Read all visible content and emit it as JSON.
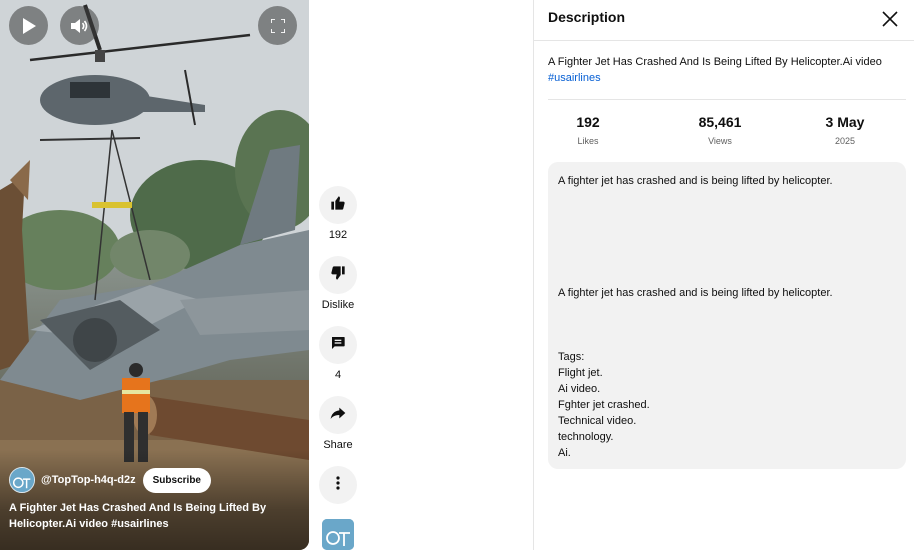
{
  "video": {
    "channel_handle": "@TopTop-h4q-d2z",
    "subscribe_label": "Subscribe",
    "title": "A Fighter Jet Has Crashed And Is Being Lifted By Helicopter.Ai video",
    "hashtag": "#usairlines"
  },
  "actions": {
    "like_count": "192",
    "dislike_label": "Dislike",
    "comment_count": "4",
    "share_label": "Share"
  },
  "panel": {
    "title": "Description",
    "summary": "A Fighter Jet Has Crashed And Is Being Lifted By Helicopter.Ai video",
    "hashtag": "#usairlines",
    "stats": [
      {
        "value": "192",
        "label": "Likes"
      },
      {
        "value": "85,461",
        "label": "Views"
      },
      {
        "value": "3 May",
        "label": "2025"
      }
    ],
    "description": {
      "line1": "A fighter jet has crashed and is being lifted by helicopter.",
      "line2": "A fighter jet has crashed and is being lifted by helicopter.",
      "tags_heading": "Tags:",
      "tags": [
        "Flight jet.",
        "Ai video.",
        "Fghter jet crashed.",
        "Technical video.",
        "technology.",
        "Ai."
      ]
    }
  },
  "colors": {
    "link": "#065fd4",
    "desc_bg": "#f2f2f2",
    "action_bg": "#f2f2f2"
  },
  "icons": [
    "play-icon",
    "volume-icon",
    "fullscreen-icon",
    "thumb-up-icon",
    "thumb-down-icon",
    "comment-icon",
    "share-icon",
    "more-vert-icon",
    "close-icon"
  ]
}
